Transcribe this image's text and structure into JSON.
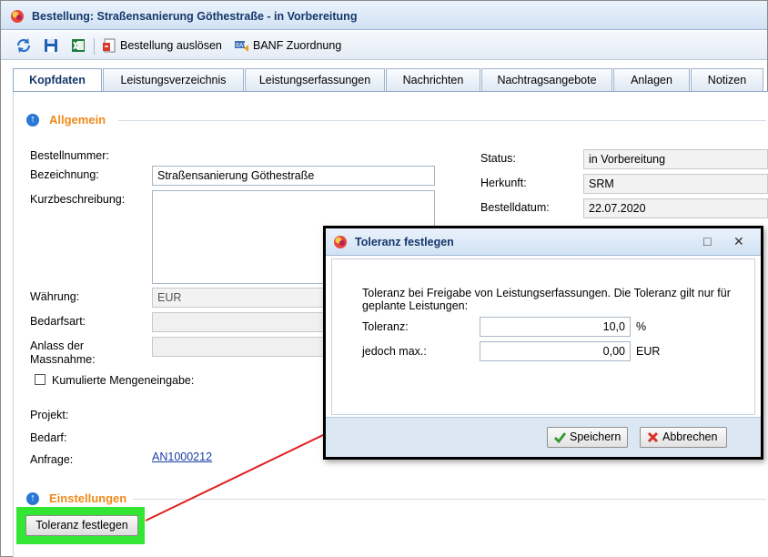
{
  "window": {
    "title": "Bestellung: Straßensanierung Göthestraße - in Vorbereitung"
  },
  "toolbar": {
    "refresh_icon": "refresh-icon",
    "save_icon": "save-icon",
    "excel_icon": "excel-icon",
    "order_label": "Bestellung auslösen",
    "banf_label": "BANF Zuordnung"
  },
  "tabs": [
    {
      "label": "Kopfdaten"
    },
    {
      "label": "Leistungsverzeichnis"
    },
    {
      "label": "Leistungserfassungen"
    },
    {
      "label": "Nachrichten"
    },
    {
      "label": "Nachtragsangebote"
    },
    {
      "label": "Anlagen"
    },
    {
      "label": "Notizen"
    }
  ],
  "allgemein": {
    "title": "Allgemein",
    "bestellnummer_label": "Bestellnummer:",
    "bezeichnung_label": "Bezeichnung:",
    "bezeichnung_value": "Straßensanierung Göthestraße",
    "kurzbeschreibung_label": "Kurzbeschreibung:",
    "waehrung_label": "Währung:",
    "waehrung_value": "EUR",
    "bedarfsart_label": "Bedarfsart:",
    "anlass_label_1": "Anlass der",
    "anlass_label_2": "Massnahme:",
    "kumuliert_label": "Kumulierte Mengeneingabe:",
    "projekt_label": "Projekt:",
    "bedarf_label": "Bedarf:",
    "anfrage_label": "Anfrage:",
    "anfrage_link": "AN1000212",
    "status_label": "Status:",
    "status_value": "in Vorbereitung",
    "herkunft_label": "Herkunft:",
    "herkunft_value": "SRM",
    "bestelldatum_label": "Bestelldatum:",
    "bestelldatum_value": "22.07.2020"
  },
  "einstellungen": {
    "title": "Einstellungen",
    "toleranz_button": "Toleranz festlegen"
  },
  "dialog": {
    "title": "Toleranz festlegen",
    "description_1": "Toleranz bei Freigabe von Leistungserfassungen. Die Toleranz gilt nur für",
    "description_2": "geplante Leistungen:",
    "toleranz_label": "Toleranz:",
    "toleranz_value": "10,0",
    "toleranz_unit": "%",
    "max_label": "jedoch max.:",
    "max_value": "0,00",
    "max_unit": "EUR",
    "save_label": "Speichern",
    "cancel_label": "Abbrechen"
  },
  "colors": {
    "section_title": "#f08a1a",
    "highlight": "#33e633",
    "annotation_arrow": "#e02020",
    "link": "#1a3da8"
  }
}
